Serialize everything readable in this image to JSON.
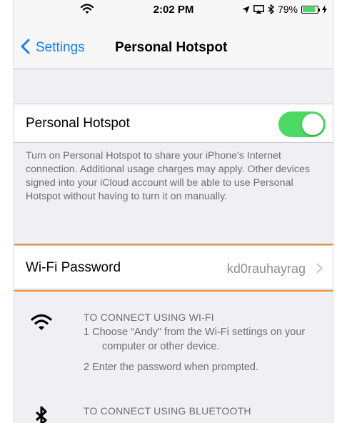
{
  "status_bar": {
    "time": "2:02 PM",
    "battery_percent": "79%",
    "battery_level": 0.79,
    "icons": [
      "wifi-icon",
      "location-icon",
      "screen-mirroring-icon",
      "bluetooth-icon",
      "battery-icon",
      "charging-icon"
    ]
  },
  "nav": {
    "back_label": "Settings",
    "title": "Personal Hotspot"
  },
  "hotspot": {
    "label": "Personal Hotspot",
    "enabled": true,
    "toggle_color": "#4cd964",
    "description": "Turn on Personal Hotspot to share your iPhone's Internet connection. Additional usage charges may apply. Other devices signed into your iCloud account will be able to use Personal Hotspot without having to turn it on manually."
  },
  "wifi_password": {
    "label": "Wi-Fi Password",
    "value": "kd0rauhayrag",
    "highlight_color": "#f0902f"
  },
  "instructions": {
    "wifi": {
      "heading": "TO CONNECT USING WI-FI",
      "step1": "1 Choose “Andy” from the Wi-Fi settings on your",
      "step1_cont": "computer or other device.",
      "step2": "2 Enter the password when prompted."
    },
    "bluetooth": {
      "heading": "TO CONNECT USING BLUETOOTH"
    }
  },
  "colors": {
    "accent": "#147efb",
    "background": "#efeff4",
    "secondary_text": "#6d6d72"
  }
}
